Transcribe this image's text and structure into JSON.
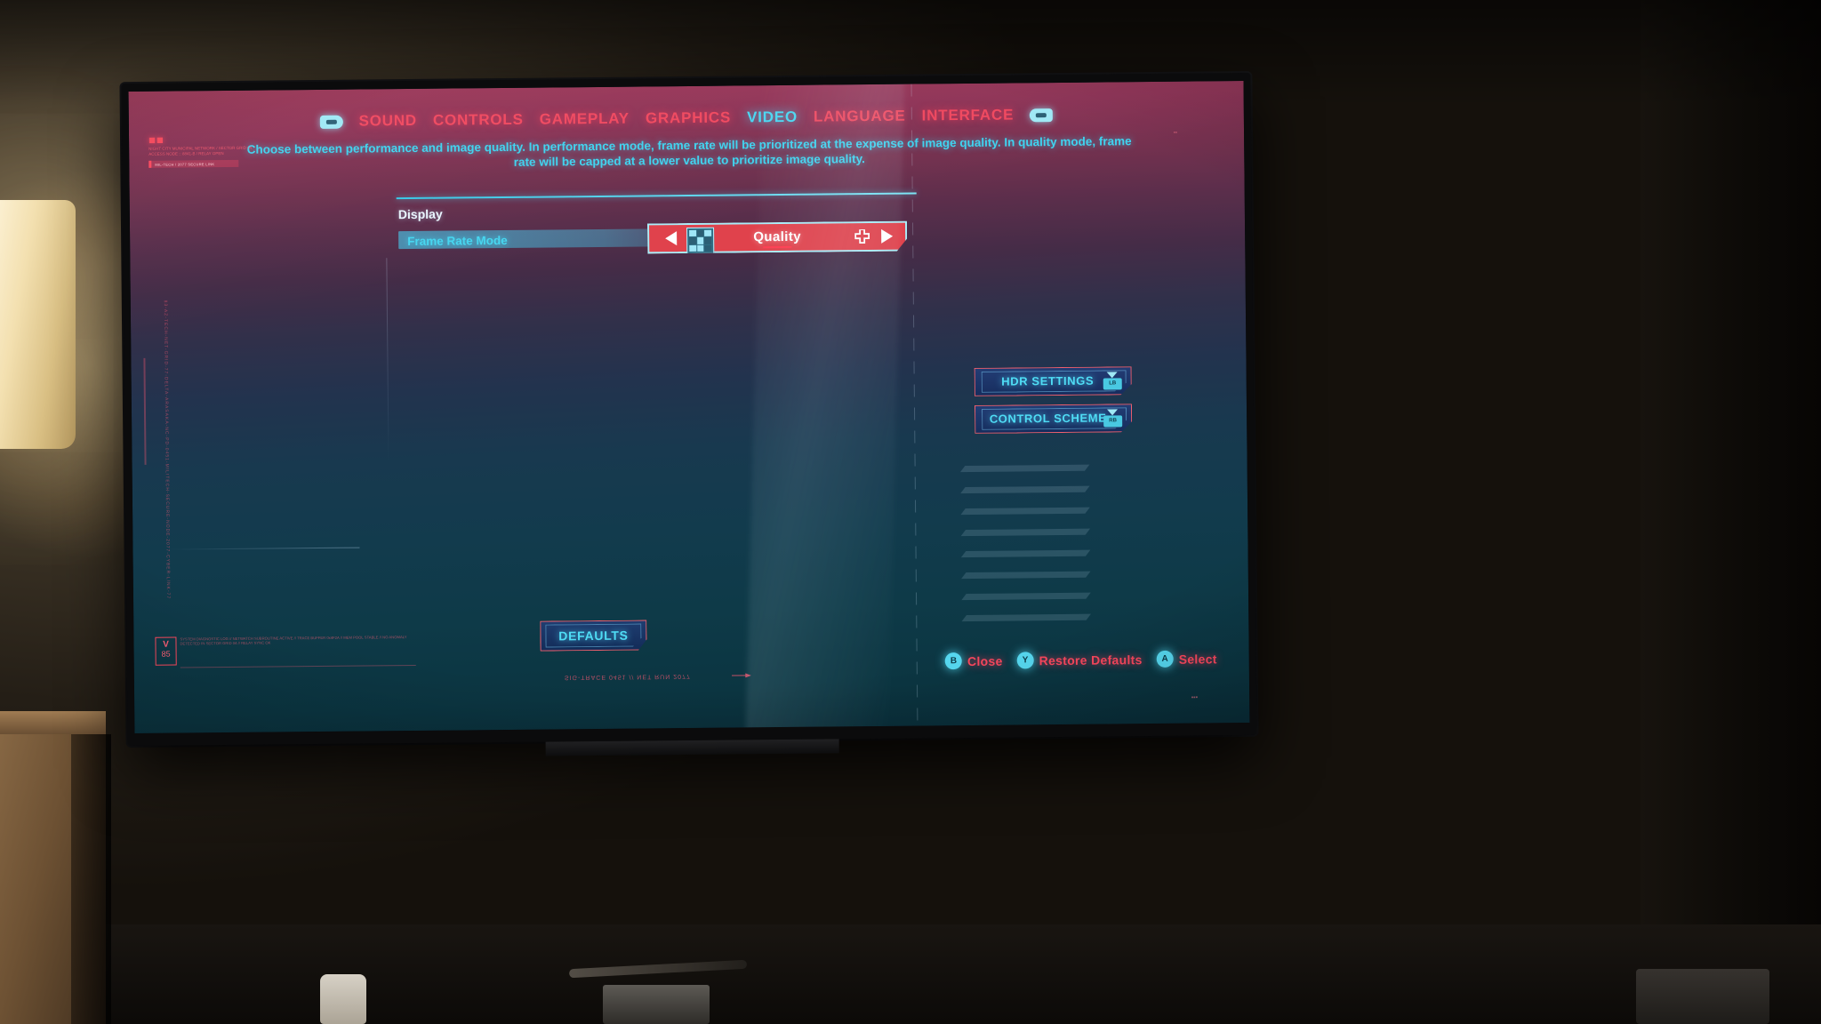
{
  "screen": {
    "nav": {
      "left_bumper_icon": "left-bumper-icon",
      "right_bumper_icon": "right-bumper-icon",
      "tabs": [
        {
          "label": "SOUND",
          "active": false
        },
        {
          "label": "CONTROLS",
          "active": false
        },
        {
          "label": "GAMEPLAY",
          "active": false
        },
        {
          "label": "GRAPHICS",
          "active": false
        },
        {
          "label": "VIDEO",
          "active": true
        },
        {
          "label": "LANGUAGE",
          "active": false
        },
        {
          "label": "INTERFACE",
          "active": false
        }
      ]
    },
    "description": "Choose between performance and image quality. In performance mode, frame rate will be prioritized at the expense of image quality. In quality mode, frame rate will be capped at a lower value to prioritize image quality.",
    "brand": {
      "mark": "■■",
      "sub": "NIGHT CITY MUNICIPAL NETWORK / SECTOR GRID 04\nACCESS NODE :: 8841-B / RELAY OPEN",
      "bar_text": "MIL-TECH / 2077 SECURE LINK"
    },
    "vertical_glyphs": "83-AZ-TECH-NET-GRID-77-DELTA-ARASAKA-NC-PD-0451-MILITECH-SECURE-NODE-2077-CYBER-LINK-77",
    "version": {
      "line1": "V",
      "line2": "85",
      "notes": "SYSTEM DIAGNOSTIC LOG // NETWATCH SUBROUTINE ACTIVE // TRACE BUFFER 0x4F2A // MEM POOL STABLE // NO ANOMALY DETECTED IN SECTOR GRID 04 // RELAY SYNC OK"
    },
    "bottom_code": "SIG-TRACE 0451 // NET RUN 2077",
    "section": {
      "title": "Display",
      "rows": [
        {
          "label": "Frame Rate Mode",
          "value": "Quality",
          "left_arrow_icon": "left-arrow-icon",
          "glyph_icon": "qr-glyph-icon",
          "dpad_icon": "dpad-icon",
          "right_arrow_icon": "right-arrow-icon"
        }
      ]
    },
    "side_buttons": [
      {
        "label": "HDR SETTINGS",
        "badge": "LB",
        "badge_icon": "bumper-badge-icon"
      },
      {
        "label": "CONTROL SCHEME",
        "badge": "RB",
        "badge_icon": "bumper-badge-icon"
      }
    ],
    "defaults_button": "DEFAULTS",
    "prompts": [
      {
        "button": "B",
        "label": "Close"
      },
      {
        "button": "Y",
        "label": "Restore Defaults"
      },
      {
        "button": "A",
        "label": "Select"
      }
    ],
    "colors": {
      "accent_red": "#f8475d",
      "accent_cyan": "#4fdcf5",
      "selector_fill": "#e0424c",
      "selector_border": "#a9eef9",
      "header_top": "#9e3758",
      "header_bottom": "#092c37"
    },
    "misc_marks": {
      "corner_tag": "▪▪",
      "corner_tag_2": "▪▪▪"
    }
  }
}
